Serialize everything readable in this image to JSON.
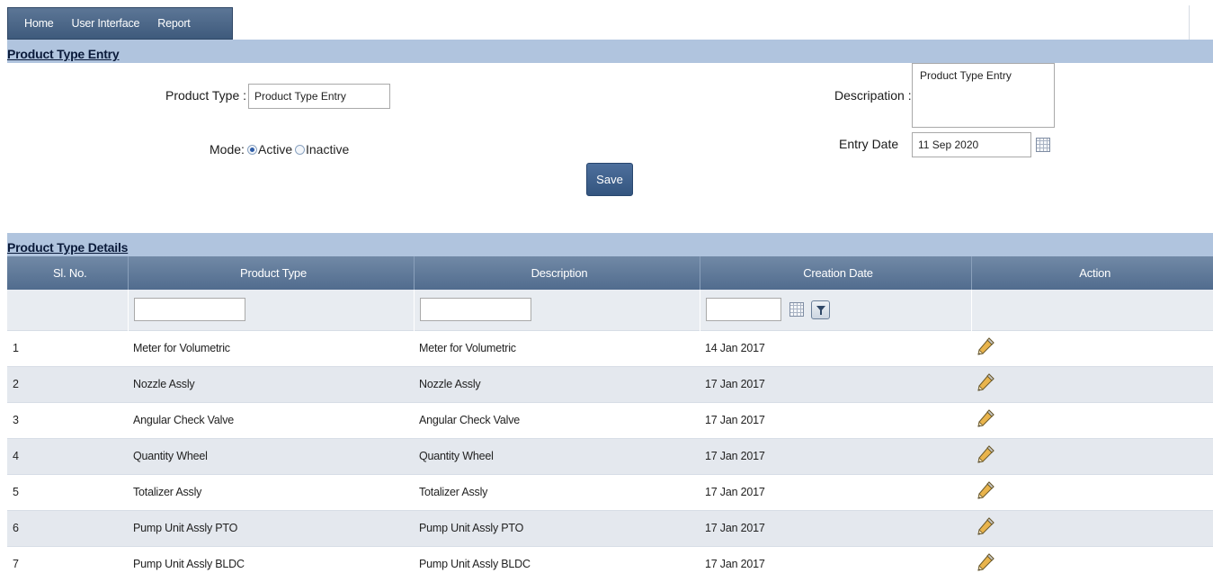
{
  "menu": {
    "items": [
      "Home",
      "User Interface",
      "Report"
    ]
  },
  "entry": {
    "section_title": "Product Type Entry",
    "product_type_label": "Product Type :",
    "product_type_value": "Product Type Entry",
    "description_label": "Descripation :",
    "description_value": "Product Type Entry",
    "mode_label": "Mode:",
    "mode_active": "Active",
    "mode_inactive": "Inactive",
    "mode_selected": "Active",
    "entry_date_label": "Entry Date",
    "entry_date_value": "11 Sep 2020",
    "save_label": "Save"
  },
  "details": {
    "section_title": "Product Type Details",
    "columns": [
      "Sl. No.",
      "Product Type",
      "Description",
      "Creation Date",
      "Action"
    ],
    "rows": [
      [
        "1",
        "Meter for Volumetric",
        "Meter for Volumetric",
        "14 Jan 2017"
      ],
      [
        "2",
        "Nozzle Assly",
        "Nozzle Assly",
        "17 Jan 2017"
      ],
      [
        "3",
        "Angular Check Valve",
        "Angular Check Valve",
        "17 Jan 2017"
      ],
      [
        "4",
        "Quantity Wheel",
        "Quantity Wheel",
        "17 Jan 2017"
      ],
      [
        "5",
        "Totalizer Assly",
        "Totalizer Assly",
        "17 Jan 2017"
      ],
      [
        "6",
        "Pump Unit Assly PTO",
        "Pump Unit Assly PTO",
        "17 Jan 2017"
      ],
      [
        "7",
        "Pump Unit Assly BLDC",
        "Pump Unit Assly BLDC",
        "17 Jan 2017"
      ]
    ]
  },
  "icons": {
    "calendar": "calendar-icon",
    "filter": "filter-icon",
    "edit": "pencil-edit-icon"
  },
  "colors": {
    "menu_bg": "#4a6587",
    "section_bg": "#b0c4de",
    "header_bg": "#5f7a9b",
    "alt_row": "#e4e8ee"
  }
}
